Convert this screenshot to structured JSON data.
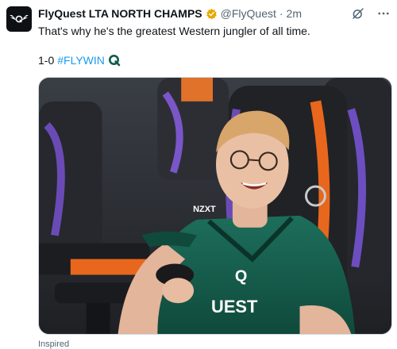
{
  "author": {
    "display_name": "FlyQuest LTA NORTH CHAMPS",
    "handle": "@FlyQuest",
    "separator": "·",
    "time": "2m",
    "verified_color": "#f4b400"
  },
  "tweet": {
    "text": "That's why he's the greatest Western jungler of all time.",
    "score": "1-0",
    "hashtag": "#FLYWIN",
    "emoji_icon": "flyquest-q-icon"
  },
  "media": {
    "alt_icon": "photo"
  },
  "footer": {
    "label": "Inspired"
  },
  "colors": {
    "hashtag": "#1d9bf0",
    "muted": "#536471",
    "brand_green": "#0e5c4a",
    "accent_orange": "#e8671c"
  },
  "icons": [
    "flyquest-logo-icon",
    "verified-badge-icon",
    "grok-icon",
    "more-options-icon"
  ]
}
